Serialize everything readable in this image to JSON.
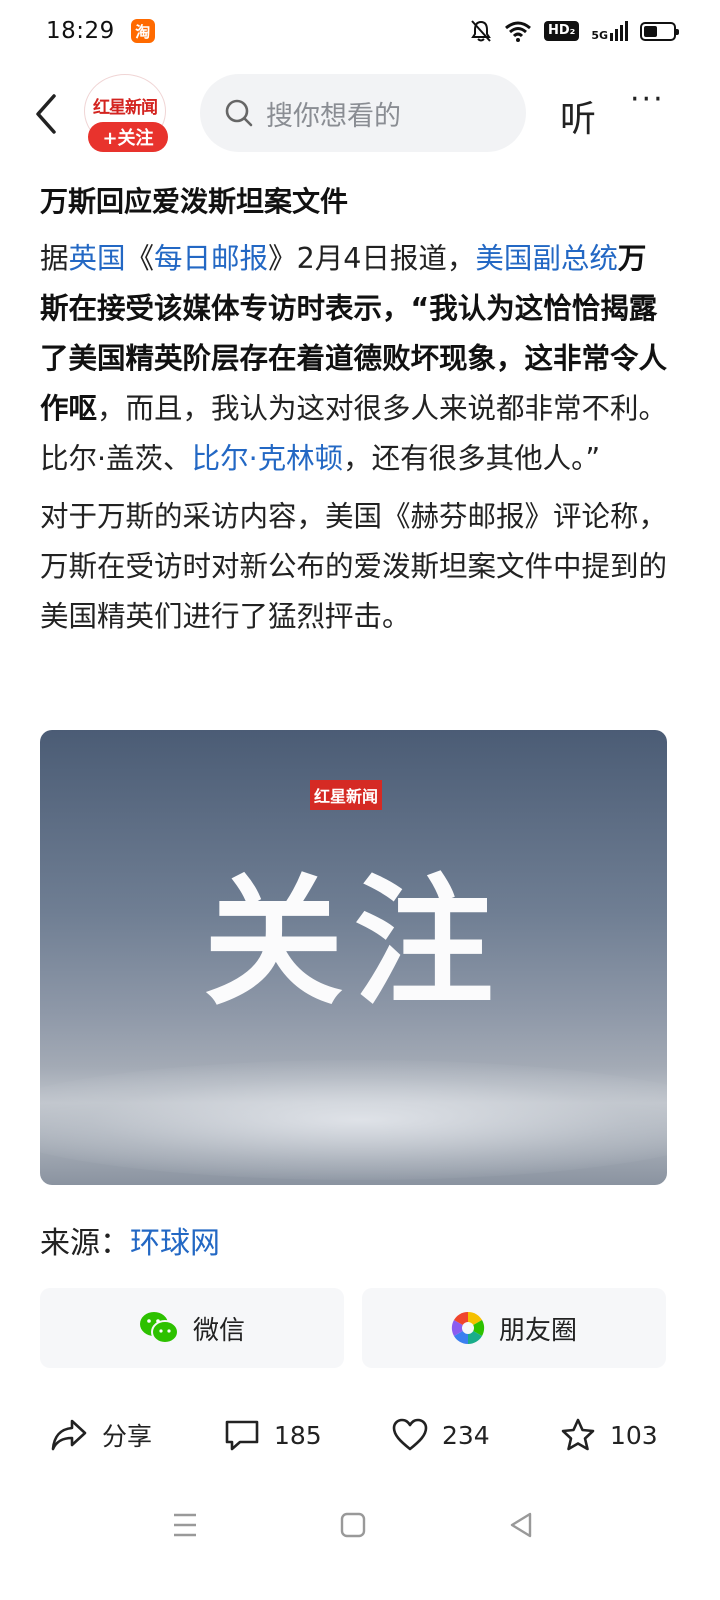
{
  "status_bar": {
    "time": "18:29",
    "app_badge": "淘",
    "hd_label": "HD₂",
    "network_label": "5G",
    "battery_level": 0.45
  },
  "nav": {
    "avatar_logo": "红星新闻",
    "follow_label": "+关注",
    "search_placeholder": "搜你想看的",
    "listen_label": "听",
    "more_label": "···"
  },
  "article": {
    "headline": "万斯回应爱泼斯坦案文件",
    "p1": {
      "t1": "据",
      "link1": "英国",
      "t2": "《",
      "link2": "每日邮报",
      "t3": "》2月4日报道，",
      "link3": "美国副总统",
      "bold1": "万斯在接受该媒体专访时表示，“我认为这恰恰揭露了美国精英阶层存在着道德败坏现象，这非常令人作呕",
      "t4": "，而且，我认为这对很多人来说都非常不利。比尔·盖茨、",
      "link4": "比尔·克林顿",
      "t5": "，还有很多其他人。”"
    },
    "p2": "对于万斯的采访内容，美国《赫芬邮报》评论称，万斯在受访时对新公布的爱泼斯坦案文件中提到的美国精英们进行了猛烈抨击。",
    "image": {
      "logo": "红星新闻",
      "big_text": "关注"
    },
    "source_label": "来源：",
    "source_link": "环球网"
  },
  "share": {
    "wechat": "微信",
    "moments": "朋友圈"
  },
  "actions": {
    "share": "分享",
    "comments": "185",
    "likes": "234",
    "favorites": "103"
  },
  "colors": {
    "link": "#2368c4",
    "brand_red": "#e8332d",
    "wechat_green": "#2dc100"
  }
}
